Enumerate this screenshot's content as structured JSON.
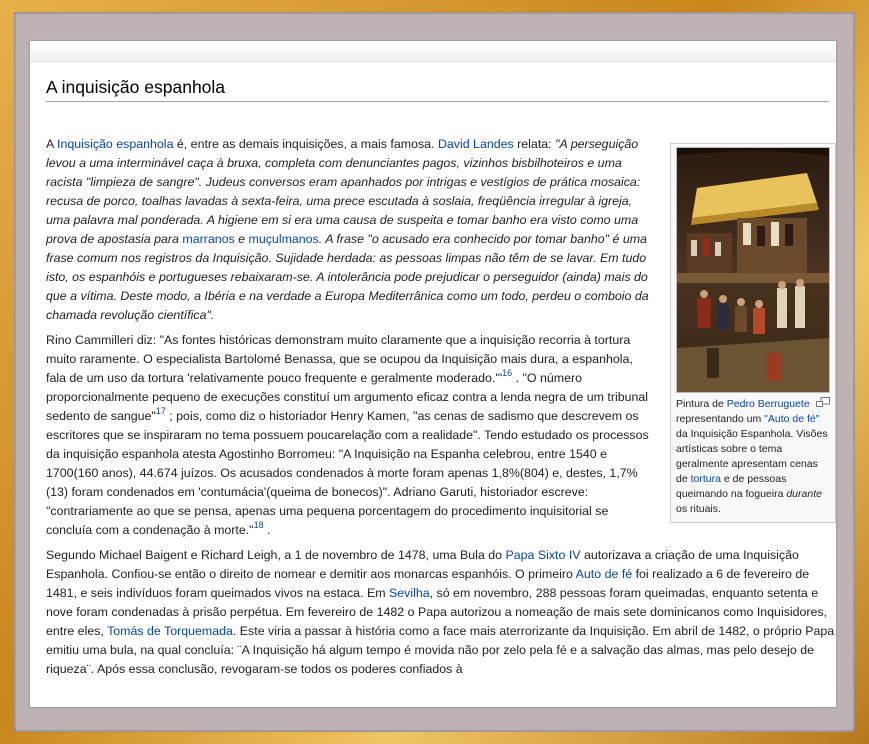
{
  "article": {
    "title": "A inquisição espanhola"
  },
  "figure": {
    "caption_prefix": "Pintura de ",
    "caption_link_painter": "Pedro Berruguete",
    "caption_mid": " representando um ",
    "caption_link_auto": "\"Auto de fé\"",
    "caption_after_auto": " da Inquisição Espanhola. Visões artísticas sobre o tema geralmente apresentam cenas de ",
    "caption_link_tortura": "tortura",
    "caption_after_tortura": " e de pessoas queimando na fogueira ",
    "caption_em": "durante",
    "caption_end": " os rituais."
  },
  "p1": {
    "t1": "A ",
    "link_inquisicao": "Inquisição espanhola",
    "t2": " é, entre as demais inquisições, a mais famosa. ",
    "link_landes": "David Landes",
    "t3": " relata: ",
    "q1": "\"A perseguição levou a uma interminável caça à bruxa, completa com denunciantes pagos, vizinhos bisbilhoteiros e uma racista \"limpieza de sangre\". Judeus conversos eram apanhados por intrigas e vestígios de prática mosaica: recusa de porco, toalhas lavadas à sexta-feira, uma prece escutada à soslaia, freqüência irregular à igreja, uma palavra mal ponderada. A higiene em si era uma causa de suspeita e tomar banho era visto como uma prova de apostasia para ",
    "link_marranos": "marranos",
    "q2": " e ",
    "link_mucul": "muçulmanos",
    "q3": ". A frase \"o acusado era conhecido por tomar banho\" é uma frase comum nos registros da Inquisição. Sujidade herdada: as pessoas limpas não têm de se lavar. Em tudo isto, os espanhóis e portugueses rebaixaram-se. A intolerância pode prejudicar o perseguidor (ainda) mais do que a vítima. Deste modo, a Ibéria e na verdade a Europa Mediterrânica como um todo, perdeu o comboio da chamada revolução científica\"."
  },
  "p2": {
    "t1": "Rino Cammilleri diz: \"As fontes históricas demonstram muito claramente que a inquisição recorria à tortura muito raramente. O especialista Bartolomé Benassa, que se ocupou da Inquisição mais dura, a espanhola, fala de um uso da tortura 'relativamente pouco frequente e geralmente moderado.'\"",
    "ref16": "16",
    "t2": " . \"O número proporcionalmente pequeno de execuções constituí um argumento eficaz contra a lenda negra de um tribunal sedento de sangue\"",
    "ref17": "17",
    "t3": " ; pois, como diz o historiador Henry Kamen, \"as cenas de sadismo que descrevem os escritores que se inspiraram no tema possuem poucarelação com a realidade\". Tendo estudado os processos da inquisição espanhola atesta Agostinho Borromeu: \"A Inquisição na Espanha celebrou, entre 1540 e 1700(160 anos), 44.674 juízos. Os acusados condenados à morte foram apenas 1,8%(804) e, destes, 1,7%(13) foram condenados em 'contumácia'(queima de bonecos)\". Adriano Garuti, historiador escreve: \"contrariamente ao que se pensa, apenas uma pequena porcentagem do procedimento inquisitorial se concluía com a condenação à morte.\"",
    "ref18": "18",
    "t4": " ."
  },
  "p3": {
    "t1": "Segundo Michael Baigent e Richard Leigh, a 1 de novembro de 1478, uma Bula do ",
    "link_papa": "Papa Sixto IV",
    "t2": " autorizava a criação de uma Inquisição Espanhola. Confiou-se então o direito de nomear e demitir aos monarcas espanhóis. O primeiro ",
    "link_auto": "Auto de fé",
    "t3": " foi realizado a 6 de fevereiro de 1481, e seis indivíduos foram queimados vivos na estaca. Em ",
    "link_sevilha": "Sevilha",
    "t4": ", só em novembro, 288 pessoas foram queimadas, enquanto setenta e nove foram condenadas à prisão perpétua. Em fevereiro de 1482 o Papa autorizou a nomeação de mais sete dominicanos como Inquisidores, entre eles, ",
    "link_torquemada": "Tomás de Torquemada",
    "t5": ". Este viria a passar à história como a face mais aterrorizante da Inquisição. Em abril de 1482, o próprio Papa emitiu uma bula, na qual concluía: ¨A Inquisição há algum tempo é movida não por zelo pela fé e a salvação das almas, mas pelo desejo de riqueza¨. Após essa conclusão, revogaram-se todos os poderes confiados à"
  },
  "colors": {
    "link": "#0645ad",
    "frame_gold": "#d9a03a",
    "frame_mat": "#bdb3b3"
  }
}
